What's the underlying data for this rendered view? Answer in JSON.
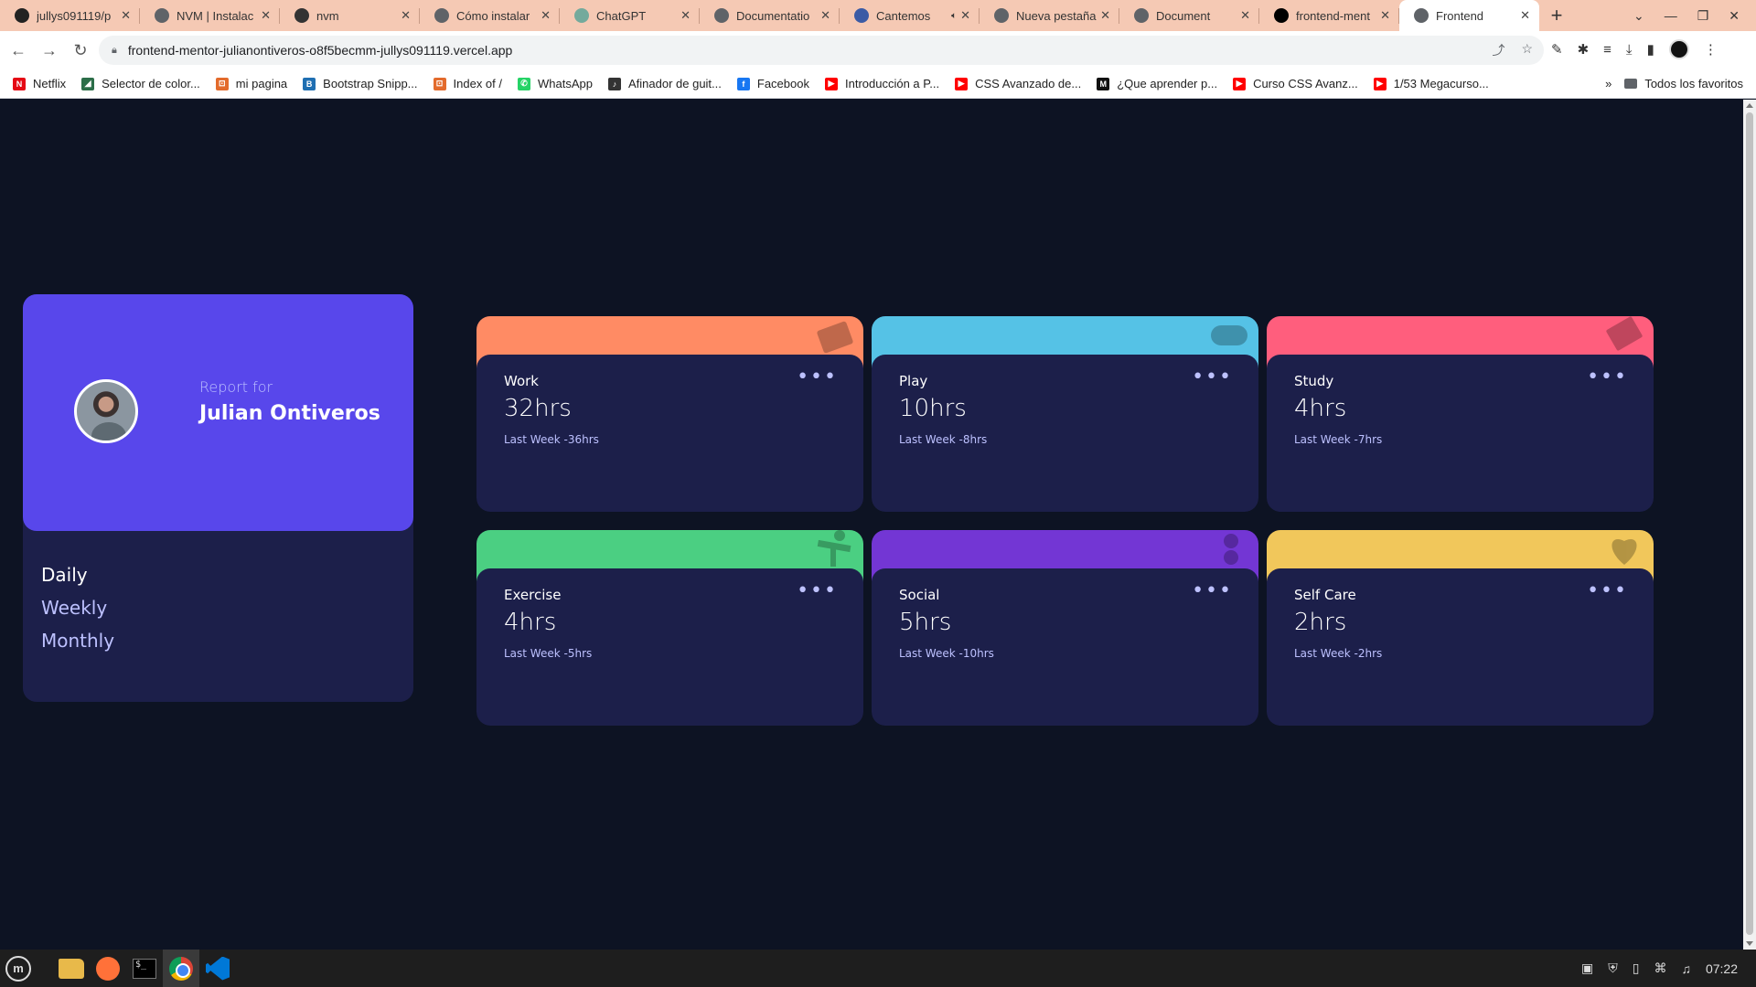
{
  "browser": {
    "tabs": [
      {
        "title": "jullys091119/p",
        "favicon": "github-icon",
        "color": "#222222"
      },
      {
        "title": "NVM | Instalac",
        "favicon": "globe-icon",
        "color": "#5f6368"
      },
      {
        "title": "nvm",
        "favicon": "link-icon",
        "color": "#333333"
      },
      {
        "title": "Cómo instalar",
        "favicon": "search-icon",
        "color": "#5f6368"
      },
      {
        "title": "ChatGPT",
        "favicon": "chatgpt-icon",
        "color": "#74aa9c"
      },
      {
        "title": "Documentatio",
        "favicon": "globe-icon",
        "color": "#5f6368"
      },
      {
        "title": "Cantemos",
        "favicon": "jw-icon",
        "color": "#3b5ba5"
      },
      {
        "title": "Nueva pestaña",
        "favicon": "globe-icon",
        "color": "#5f6368"
      },
      {
        "title": "Document",
        "favicon": "globe-icon",
        "color": "#5f6368"
      },
      {
        "title": "frontend-ment",
        "favicon": "vercel-icon",
        "color": "#000000"
      },
      {
        "title": "Frontend",
        "favicon": "globe-icon",
        "color": "#5f6368"
      }
    ],
    "url": "frontend-mentor-julianontiveros-o8f5becmm-jullys091119.vercel.app",
    "bookmarks": [
      {
        "label": "Netflix",
        "icon": "netflix-icon",
        "color": "#e50914",
        "glyph": "N"
      },
      {
        "label": "Selector de color...",
        "icon": "color-picker-icon",
        "color": "#2c6e49",
        "glyph": "◢"
      },
      {
        "label": "mi pagina",
        "icon": "html-icon",
        "color": "#e36b2c",
        "glyph": "⊡"
      },
      {
        "label": "Bootstrap Snipp...",
        "icon": "bootstrap-icon",
        "color": "#1f6fb2",
        "glyph": "B"
      },
      {
        "label": "Index of /",
        "icon": "html-icon",
        "color": "#e36b2c",
        "glyph": "⊡"
      },
      {
        "label": "WhatsApp",
        "icon": "whatsapp-icon",
        "color": "#25d366",
        "glyph": "✆"
      },
      {
        "label": "Afinador de guit...",
        "icon": "tuner-icon",
        "color": "#333333",
        "glyph": "♪"
      },
      {
        "label": "Facebook",
        "icon": "facebook-icon",
        "color": "#1877f2",
        "glyph": "f"
      },
      {
        "label": "Introducción a P...",
        "icon": "youtube-icon",
        "color": "#ff0000",
        "glyph": "▶"
      },
      {
        "label": "CSS Avanzado de...",
        "icon": "youtube-icon",
        "color": "#ff0000",
        "glyph": "▶"
      },
      {
        "label": "¿Que aprender p...",
        "icon": "medium-icon",
        "color": "#111111",
        "glyph": "M"
      },
      {
        "label": "Curso CSS Avanz...",
        "icon": "youtube-icon",
        "color": "#ff0000",
        "glyph": "▶"
      },
      {
        "label": "1/53 Megacurso...",
        "icon": "youtube-icon",
        "color": "#ff0000",
        "glyph": "▶"
      }
    ],
    "all_bookmarks_label": "Todos los favoritos"
  },
  "profile": {
    "report_label": "Report for",
    "name": "Julian Ontiveros",
    "periods": [
      "Daily",
      "Weekly",
      "Monthly"
    ]
  },
  "activities": [
    {
      "title": "Work",
      "current": "32hrs",
      "previous": "Last Week -36hrs",
      "color": "#ff8b64",
      "icon": "work-icon"
    },
    {
      "title": "Play",
      "current": "10hrs",
      "previous": "Last Week -8hrs",
      "color": "#55c2e6",
      "icon": "play-icon"
    },
    {
      "title": "Study",
      "current": "4hrs",
      "previous": "Last Week -7hrs",
      "color": "#ff5e7d",
      "icon": "study-icon"
    },
    {
      "title": "Exercise",
      "current": "4hrs",
      "previous": "Last Week -5hrs",
      "color": "#4bcf82",
      "icon": "exercise-icon"
    },
    {
      "title": "Social",
      "current": "5hrs",
      "previous": "Last Week -10hrs",
      "color": "#7336d4",
      "icon": "social-icon"
    },
    {
      "title": "Self Care",
      "current": "2hrs",
      "previous": "Last Week -2hrs",
      "color": "#f1c75b",
      "icon": "self-care-icon"
    }
  ],
  "taskbar": {
    "clock": "07:22"
  }
}
